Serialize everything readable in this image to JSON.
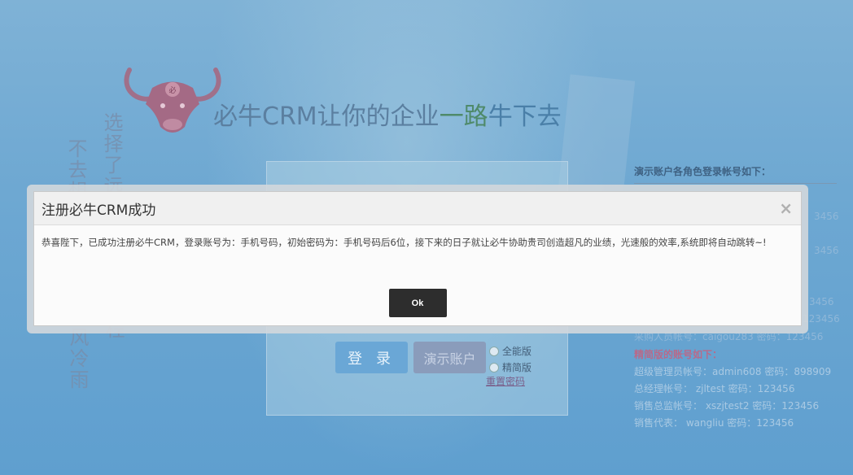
{
  "page": {
    "slogan": {
      "part1": "必牛CRM让你的企业",
      "part2": "一路",
      "part3": "牛下去"
    },
    "vertical_text": {
      "col_a": "选择了远",
      "col_b": "不去想",
      "col_c": "风冷雨",
      "col_d": "程"
    },
    "login": {
      "login_button": "登 录",
      "demo_button": "演示账户",
      "edition_full": "全能版",
      "edition_simple": "精简版",
      "reset_password": "重置密码"
    },
    "demo_accounts": {
      "title": "演示账户各角色登录帐号如下：",
      "simple_header": "精简版的账号如下：",
      "simple_items": [
        "超级管理员帐号：admin608 密码：898909",
        "总经理帐号： zjltest 密码：123456",
        "销售总监帐号： xszjtest2 密码：123456",
        "销售代表： wangliu 密码：123456"
      ],
      "faded_line": "采购人员帐号：caigou283 密码：123456",
      "faded_fragments": [
        "3456",
        "3456",
        "3456",
        "3456",
        "123456"
      ]
    }
  },
  "modal": {
    "title": "注册必牛CRM成功",
    "close_symbol": "×",
    "message": "恭喜陛下，已成功注册必牛CRM，登录账号为：手机号码，初始密码为：手机号码后6位，接下来的日子就让必牛协助贵司创造超凡的业绩，光速般的效率,系统即将自动跳转~!",
    "ok_label": "Ok"
  },
  "colors": {
    "background": "#6ea8d2",
    "modal_button": "#2d2d2d",
    "login_button": "#6aa7d6",
    "demo_button": "#8a9cbb",
    "accent_pink": "#b86a8a"
  }
}
